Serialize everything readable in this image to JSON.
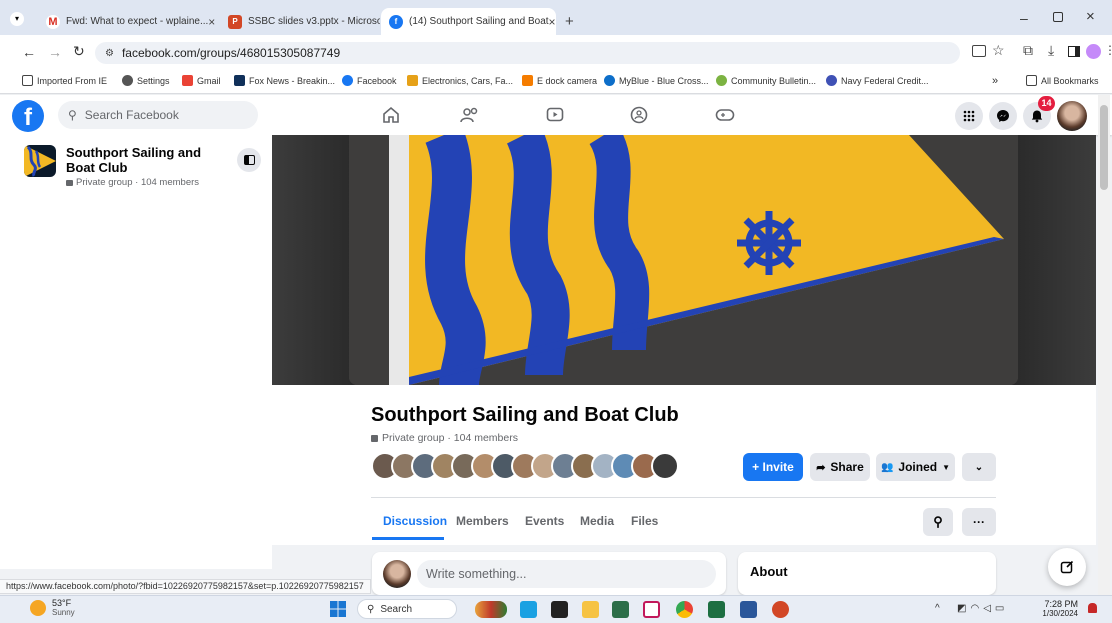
{
  "browser": {
    "tabs": [
      {
        "title": "Fwd: What to expect - wplaine...",
        "icon": "gmail-icon"
      },
      {
        "title": "SSBC slides v3.pptx - Microsoft",
        "icon": "powerpoint-icon"
      },
      {
        "title": "(14) Southport Sailing and Boat",
        "icon": "facebook-icon"
      }
    ],
    "url": "facebook.com/groups/468015305087749",
    "bookmarks": [
      "Imported From IE",
      "Settings",
      "Gmail",
      "Fox News - Breakin...",
      "Facebook",
      "Electronics, Cars, Fa...",
      "E dock camera",
      "MyBlue - Blue Cross...",
      "Community Bulletin...",
      "Navy Federal Credit..."
    ],
    "all_bookmarks": "All Bookmarks",
    "status_url": "https://www.facebook.com/photo/?fbid=10226920775982157&set=p.10226920775982157"
  },
  "fb": {
    "search_placeholder": "Search Facebook",
    "notification_count": "14",
    "sidebar_group_name": "Southport Sailing and Boat Club",
    "sidebar_group_meta": "Private group · 104 members",
    "group_name": "Southport Sailing and Boat Club",
    "group_meta": "Private group · 104 members",
    "buttons": {
      "invite": "+ Invite",
      "share": "Share",
      "joined": "Joined"
    },
    "tabs": [
      "Discussion",
      "Members",
      "Events",
      "Media",
      "Files"
    ],
    "composer_placeholder": "Write something...",
    "about_title": "About"
  },
  "taskbar": {
    "temp": "53°F",
    "weather": "Sunny",
    "search": "Search",
    "time": "7:28 PM",
    "date": "1/30/2024"
  },
  "colors": {
    "fb_blue": "#1877f2",
    "flag_yellow": "#f2b824",
    "flag_blue": "#2343b5"
  }
}
